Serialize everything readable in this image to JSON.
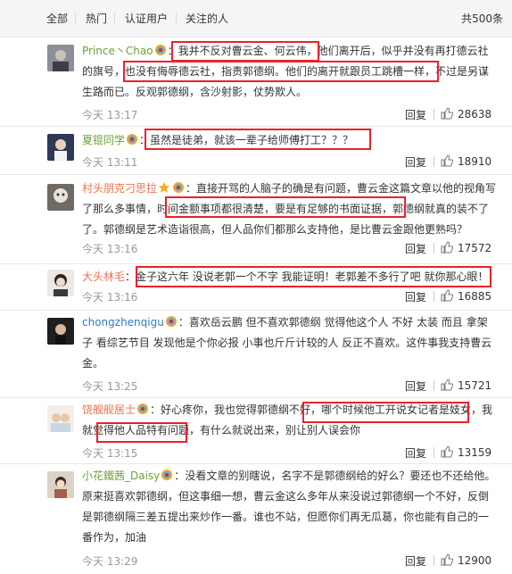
{
  "filter": {
    "tabs": [
      "全部",
      "热门",
      "认证用户",
      "关注的人"
    ],
    "count": "共500条"
  },
  "comments": [
    {
      "username": "Prince丶Chao",
      "colon": "：",
      "body": "我并不反对曹云金、何云伟，他们离开后，似乎并没有再打德云社的旗号，也没有侮辱德云社，指责郭德纲。他们的离开就跟员工跳槽一样，不过是另谋生路而已。反观郭德纲，含沙射影，仗势欺人。",
      "time": "今天 13:17",
      "reply": "回复",
      "likes": "28638"
    },
    {
      "username": "夏锟同学",
      "colon": "：",
      "body": "虽然是徒弟，就该一辈子给师傅打工？？？",
      "time": "今天 13:11",
      "reply": "回复",
      "likes": "18910"
    },
    {
      "username": "村头朋克刁思拉",
      "colon": "：",
      "body": "直接开骂的人脑子的确是有问题，曹云金这篇文章以他的视角写了那么多事情，时间金额事项都很清楚，要是有足够的书面证据，郭德纲就真的装不了了。郭德纲是艺术造诣很高，但人品你们都那么支持他，是比曹云金跟他更熟吗？",
      "time": "今天 13:16",
      "reply": "回复",
      "likes": "17572"
    },
    {
      "username": "大头林毛",
      "colon": "：",
      "body": "金子这六年 没说老郭一个不字 我能证明！老郭差不多行了吧 就你那心眼！",
      "time": "今天 13:16",
      "reply": "回复",
      "likes": "16885"
    },
    {
      "username": "chongzhenqigu",
      "colon": "：",
      "body": "喜欢岳云鹏 但不喜欢郭德纲 觉得他这个人 不好 太装 而且 拿架子 看综艺节目 发现他是个你必报 小事也斤斤计较的人 反正不喜欢。这件事我支持曹云金。",
      "time": "今天 13:25",
      "reply": "回复",
      "likes": "15721"
    },
    {
      "username": "饶舰舰居士",
      "colon": "：",
      "body": "好心疼你，我也觉得郭德纲不好，哪个时候他工开说女记者是妓女，我就觉得他人品特有问题，有什么就说出来，别让别人误会你",
      "time": "今天 13:15",
      "reply": "回复",
      "likes": "13159"
    },
    {
      "username": "小花鐵茜_Daisy",
      "colon": "：",
      "body": "没看文章的别瞎说，名字不是郭德纲给的好么？要还也不还给他。原来挺喜欢郭德纲，但这事细一想，曹云金这么多年从来没说过郭德纲一个不好，反倒是郭德纲隔三差五提出来炒作一番。谁也不站，但愿你们再无瓜葛，你也能有自己的一番作为，加油",
      "time": "今天 13:29",
      "reply": "回复",
      "likes": "12900"
    }
  ],
  "colors": {
    "highlight": "#e8232b",
    "username_orange": "#eb7350",
    "username_green": "#6ba33a",
    "username_blue": "#2f7bbf",
    "time_gray": "#999999"
  },
  "icons": [
    "rainbow-badge-icon",
    "star-badge-icon",
    "thumbs-up-icon"
  ]
}
